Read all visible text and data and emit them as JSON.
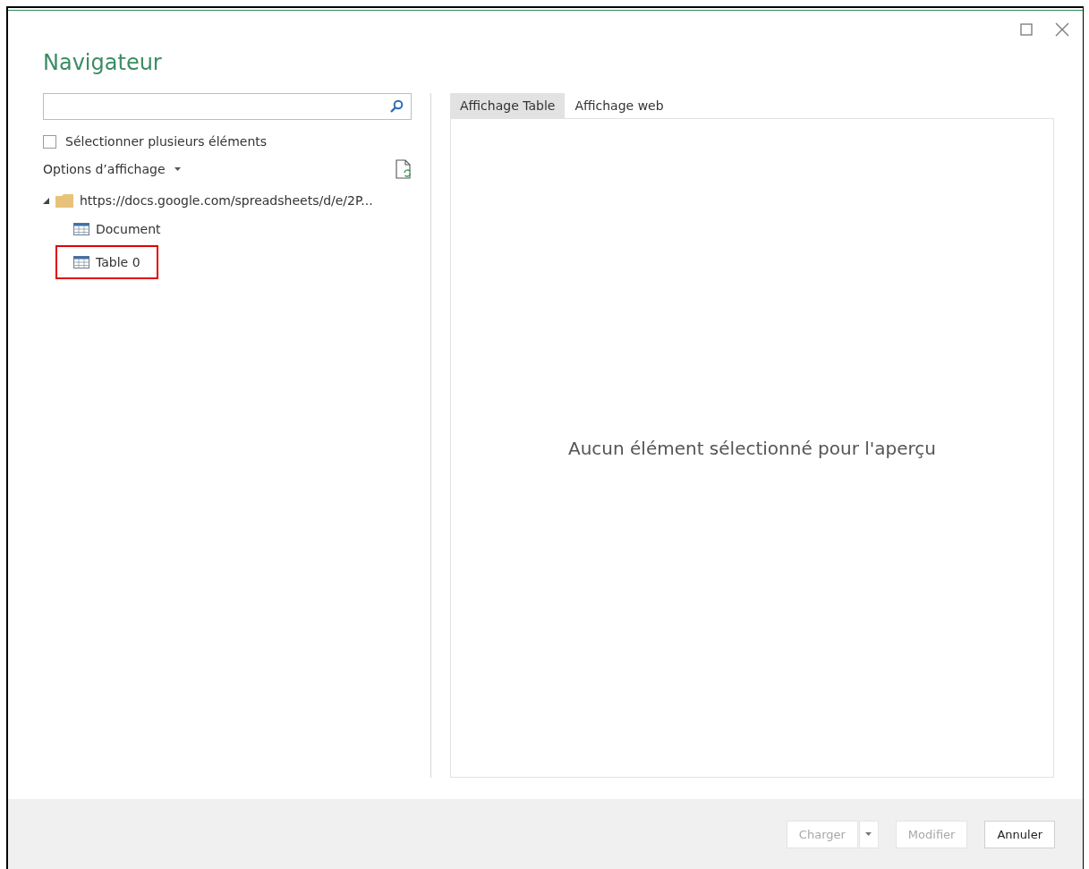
{
  "window": {
    "title": "Navigateur"
  },
  "multi_select": {
    "label": "Sélectionner plusieurs éléments",
    "checked": false
  },
  "display_options": {
    "label": "Options d’affichage"
  },
  "tree": [
    {
      "label": "https://docs.google.com/spreadsheets/d/e/2P...",
      "kind": "folder",
      "expanded": true,
      "highlighted": false,
      "children": [
        {
          "label": "Document",
          "kind": "table",
          "highlighted": false
        },
        {
          "label": "Table 0",
          "kind": "table",
          "highlighted": true
        }
      ]
    }
  ],
  "tabs": [
    {
      "label": "Affichage Table",
      "selected": true
    },
    {
      "label": "Affichage web",
      "selected": false
    }
  ],
  "preview": {
    "message": "Aucun élément sélectionné pour l'aperçu"
  },
  "buttons": [
    {
      "label": "Charger",
      "disabled": true,
      "split": true
    },
    {
      "label": "Modifier",
      "disabled": true,
      "split": false
    },
    {
      "label": "Annuler",
      "disabled": false,
      "split": false
    }
  ]
}
